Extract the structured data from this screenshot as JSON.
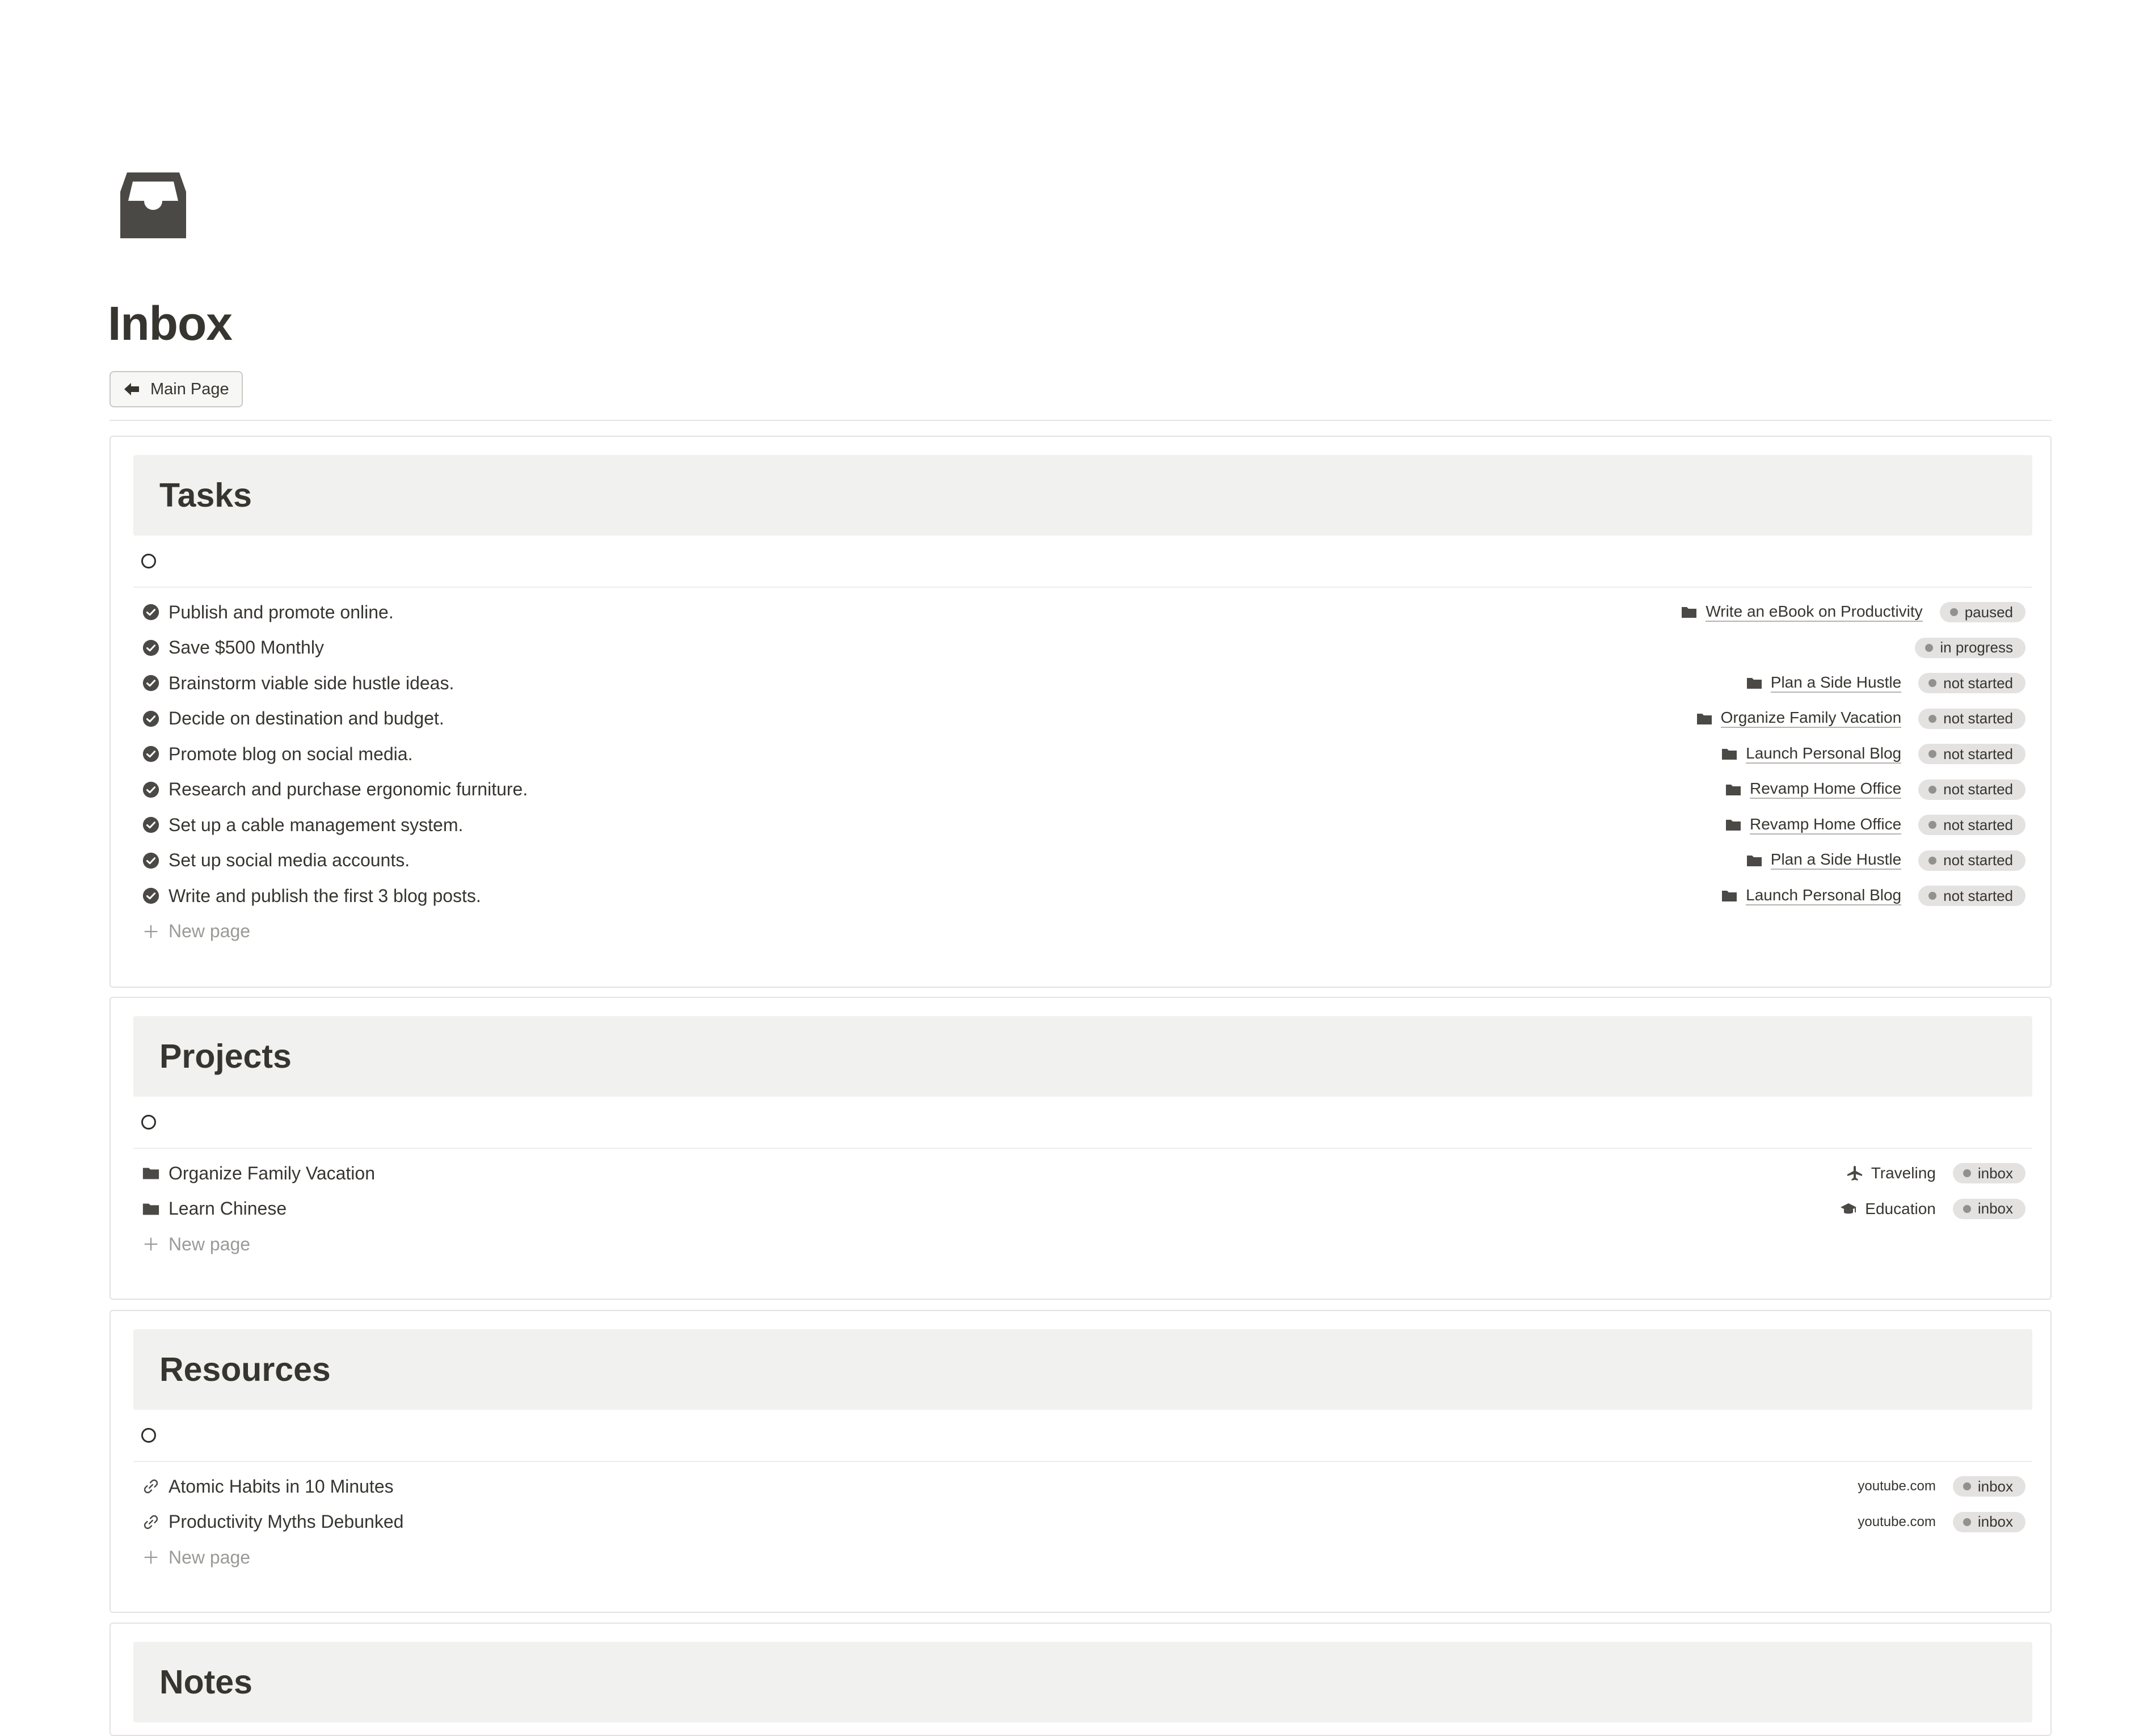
{
  "page": {
    "icon": "inbox-tray-icon",
    "title": "Inbox",
    "back_button": "Main Page"
  },
  "tasks": {
    "heading": "Tasks",
    "new_page": "New page",
    "rows": [
      {
        "title": "Publish and promote online.",
        "project": "Write an eBook on Productivity",
        "status": "paused"
      },
      {
        "title": "Save $500 Monthly",
        "project": "",
        "status": "in progress"
      },
      {
        "title": "Brainstorm viable side hustle ideas.",
        "project": "Plan a Side Hustle",
        "status": "not started"
      },
      {
        "title": "Decide on destination and budget.",
        "project": "Organize Family Vacation",
        "status": "not started"
      },
      {
        "title": "Promote blog on social media.",
        "project": "Launch Personal Blog",
        "status": "not started"
      },
      {
        "title": "Research and purchase ergonomic furniture.",
        "project": "Revamp Home Office",
        "status": "not started"
      },
      {
        "title": "Set up a cable management system.",
        "project": "Revamp Home Office",
        "status": "not started"
      },
      {
        "title": "Set up social media accounts.",
        "project": "Plan a Side Hustle",
        "status": "not started"
      },
      {
        "title": "Write and publish the first 3 blog posts.",
        "project": "Launch Personal Blog",
        "status": "not started"
      }
    ]
  },
  "projects": {
    "heading": "Projects",
    "new_page": "New page",
    "rows": [
      {
        "title": "Organize Family Vacation",
        "area": "Traveling",
        "area_icon": "airplane-icon",
        "status": "inbox"
      },
      {
        "title": "Learn Chinese",
        "area": "Education",
        "area_icon": "graduation-cap-icon",
        "status": "inbox"
      }
    ]
  },
  "resources": {
    "heading": "Resources",
    "new_page": "New page",
    "rows": [
      {
        "title": "Atomic Habits in 10 Minutes",
        "url": "youtube.com",
        "status": "inbox"
      },
      {
        "title": "Productivity Myths Debunked",
        "url": "youtube.com",
        "status": "inbox"
      }
    ]
  },
  "notes": {
    "heading": "Notes"
  },
  "colors": {
    "text": "#37352f",
    "header_bg": "#f1f1ef",
    "badge_bg": "#e3e2e0",
    "badge_dot": "#91918e",
    "muted": "#9b9a97"
  }
}
